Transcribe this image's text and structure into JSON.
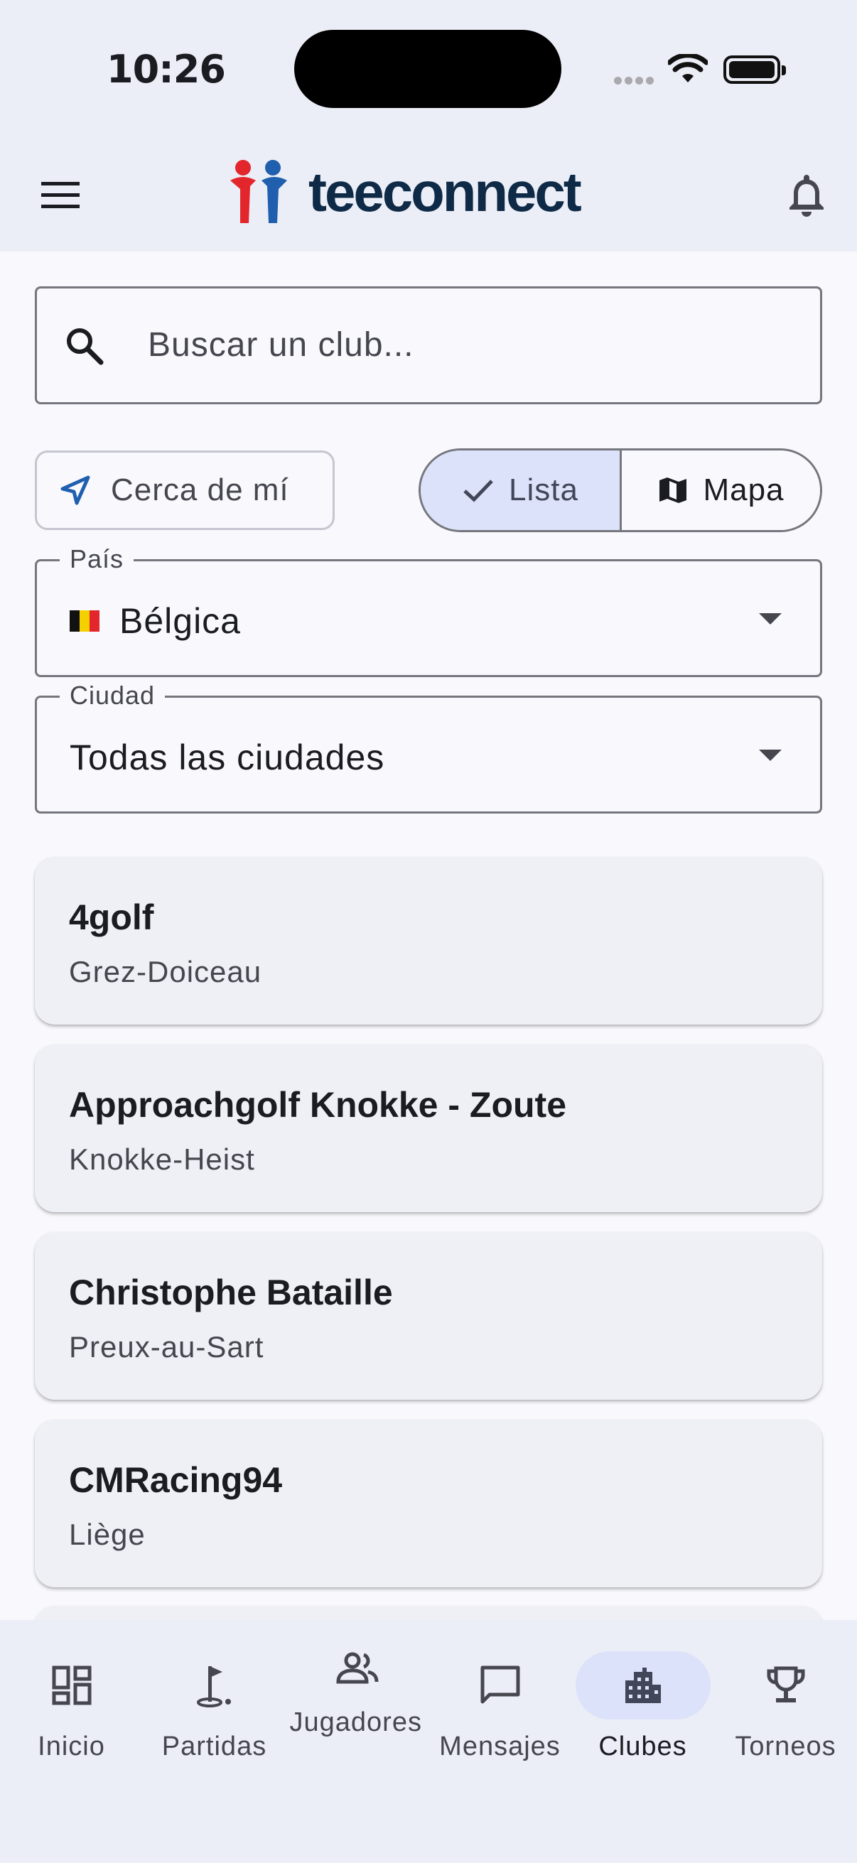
{
  "status_bar": {
    "time": "10:26"
  },
  "app": {
    "brand": "teeconnect"
  },
  "search": {
    "placeholder": "Buscar un club..."
  },
  "filters": {
    "near_me": "Cerca de mí",
    "view_toggle": {
      "list": "Lista",
      "map": "Mapa",
      "selected": "Lista"
    }
  },
  "country": {
    "label": "País",
    "value": "Bélgica"
  },
  "city": {
    "label": "Ciudad",
    "value": "Todas las ciudades"
  },
  "clubs": [
    {
      "name": "4golf",
      "city": "Grez-Doiceau"
    },
    {
      "name": "Approachgolf Knokke - Zoute",
      "city": "Knokke-Heist"
    },
    {
      "name": "Christophe Bataille",
      "city": "Preux-au-Sart"
    },
    {
      "name": "CMRacing94",
      "city": "Liège"
    }
  ],
  "nav": {
    "items": [
      {
        "label": "Inicio",
        "icon": "dashboard-icon"
      },
      {
        "label": "Partidas",
        "icon": "golf-flag-icon"
      },
      {
        "label": "Jugadores",
        "icon": "people-icon"
      },
      {
        "label": "Mensajes",
        "icon": "chat-icon"
      },
      {
        "label": "Clubes",
        "icon": "building-icon"
      },
      {
        "label": "Torneos",
        "icon": "trophy-icon"
      }
    ],
    "active": "Clubes"
  },
  "colors": {
    "brand_navy": "#0E2A47",
    "brand_red": "#E3262C",
    "brand_blue": "#1F5FAE",
    "accent_container": "#DCE2F9"
  }
}
